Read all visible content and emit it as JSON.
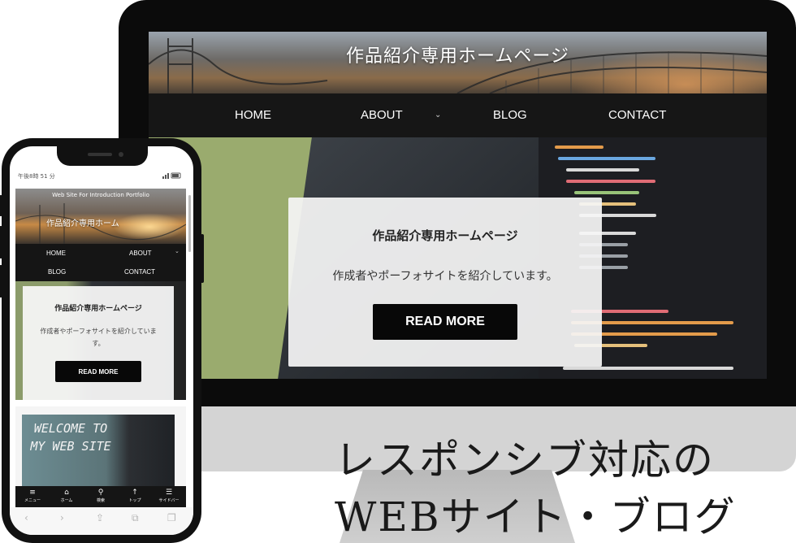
{
  "desktop": {
    "site_title": "作品紹介専用ホームページ",
    "nav": [
      {
        "label": "HOME"
      },
      {
        "label": "ABOUT",
        "has_dropdown": true
      },
      {
        "label": "BLOG"
      },
      {
        "label": "CONTACT"
      }
    ],
    "chevron": "⌄",
    "hero_card": {
      "title": "作品紹介専用ホームページ",
      "text": "作成者やポーフォサイトを紹介しています。",
      "button": "READ MORE"
    }
  },
  "phone": {
    "status_time": "午後8時 51 分",
    "header_sub": "Web Site For Introduction Portfolio",
    "header_title": "作品紹介専用ホーム",
    "nav": [
      {
        "label": "HOME"
      },
      {
        "label": "ABOUT",
        "has_dropdown": true
      },
      {
        "label": "BLOG"
      },
      {
        "label": "CONTACT"
      }
    ],
    "chevron": "⌄",
    "hero_card": {
      "title": "作品紹介専用ホームページ",
      "text": "作成者やポーフォサイトを紹介しています。",
      "button": "READ MORE"
    },
    "welcome_text": "WELCOME TO MY WEB SITE",
    "tabbar": [
      {
        "icon": "≡",
        "label": "メニュー",
        "icon_name": "menu-icon"
      },
      {
        "icon": "⌂",
        "label": "ホーム",
        "icon_name": "home-icon"
      },
      {
        "icon": "⚲",
        "label": "検索",
        "icon_name": "search-icon"
      },
      {
        "icon": "↑",
        "label": "トップ",
        "icon_name": "arrow-up-icon"
      },
      {
        "icon": "☰",
        "label": "サイドバー",
        "icon_name": "sidebar-icon"
      }
    ],
    "browser": {
      "back": "‹",
      "forward": "›",
      "share": "⇪",
      "bookmarks": "⧉",
      "tabs": "❐"
    }
  },
  "caption": {
    "line1": "レスポンシブ対応の",
    "line2": "WEBサイト・ブログ"
  },
  "colors": {
    "nav_bg": "#161616",
    "button_bg": "#080808",
    "card_bg": "#f5f5f5",
    "bezel": "#0b0b0b",
    "monitor_chin": "#d4d4d4"
  }
}
